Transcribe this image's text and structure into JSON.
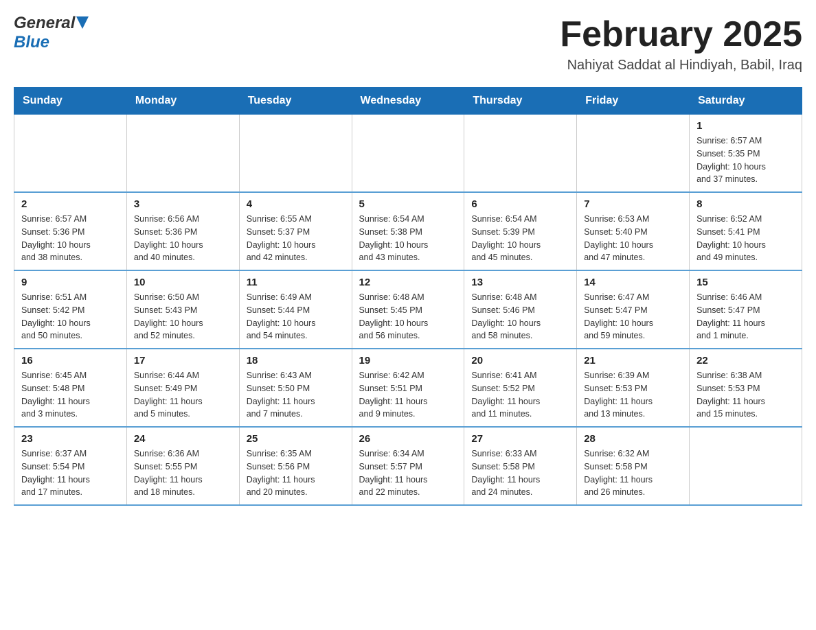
{
  "header": {
    "logo": {
      "general": "General",
      "arrow_color": "#1a6eb5",
      "blue": "Blue"
    },
    "title": "February 2025",
    "location": "Nahiyat Saddat al Hindiyah, Babil, Iraq"
  },
  "calendar": {
    "days_of_week": [
      "Sunday",
      "Monday",
      "Tuesday",
      "Wednesday",
      "Thursday",
      "Friday",
      "Saturday"
    ],
    "weeks": [
      {
        "days": [
          {
            "date": "",
            "info": ""
          },
          {
            "date": "",
            "info": ""
          },
          {
            "date": "",
            "info": ""
          },
          {
            "date": "",
            "info": ""
          },
          {
            "date": "",
            "info": ""
          },
          {
            "date": "",
            "info": ""
          },
          {
            "date": "1",
            "info": "Sunrise: 6:57 AM\nSunset: 5:35 PM\nDaylight: 10 hours\nand 37 minutes."
          }
        ]
      },
      {
        "days": [
          {
            "date": "2",
            "info": "Sunrise: 6:57 AM\nSunset: 5:36 PM\nDaylight: 10 hours\nand 38 minutes."
          },
          {
            "date": "3",
            "info": "Sunrise: 6:56 AM\nSunset: 5:36 PM\nDaylight: 10 hours\nand 40 minutes."
          },
          {
            "date": "4",
            "info": "Sunrise: 6:55 AM\nSunset: 5:37 PM\nDaylight: 10 hours\nand 42 minutes."
          },
          {
            "date": "5",
            "info": "Sunrise: 6:54 AM\nSunset: 5:38 PM\nDaylight: 10 hours\nand 43 minutes."
          },
          {
            "date": "6",
            "info": "Sunrise: 6:54 AM\nSunset: 5:39 PM\nDaylight: 10 hours\nand 45 minutes."
          },
          {
            "date": "7",
            "info": "Sunrise: 6:53 AM\nSunset: 5:40 PM\nDaylight: 10 hours\nand 47 minutes."
          },
          {
            "date": "8",
            "info": "Sunrise: 6:52 AM\nSunset: 5:41 PM\nDaylight: 10 hours\nand 49 minutes."
          }
        ]
      },
      {
        "days": [
          {
            "date": "9",
            "info": "Sunrise: 6:51 AM\nSunset: 5:42 PM\nDaylight: 10 hours\nand 50 minutes."
          },
          {
            "date": "10",
            "info": "Sunrise: 6:50 AM\nSunset: 5:43 PM\nDaylight: 10 hours\nand 52 minutes."
          },
          {
            "date": "11",
            "info": "Sunrise: 6:49 AM\nSunset: 5:44 PM\nDaylight: 10 hours\nand 54 minutes."
          },
          {
            "date": "12",
            "info": "Sunrise: 6:48 AM\nSunset: 5:45 PM\nDaylight: 10 hours\nand 56 minutes."
          },
          {
            "date": "13",
            "info": "Sunrise: 6:48 AM\nSunset: 5:46 PM\nDaylight: 10 hours\nand 58 minutes."
          },
          {
            "date": "14",
            "info": "Sunrise: 6:47 AM\nSunset: 5:47 PM\nDaylight: 10 hours\nand 59 minutes."
          },
          {
            "date": "15",
            "info": "Sunrise: 6:46 AM\nSunset: 5:47 PM\nDaylight: 11 hours\nand 1 minute."
          }
        ]
      },
      {
        "days": [
          {
            "date": "16",
            "info": "Sunrise: 6:45 AM\nSunset: 5:48 PM\nDaylight: 11 hours\nand 3 minutes."
          },
          {
            "date": "17",
            "info": "Sunrise: 6:44 AM\nSunset: 5:49 PM\nDaylight: 11 hours\nand 5 minutes."
          },
          {
            "date": "18",
            "info": "Sunrise: 6:43 AM\nSunset: 5:50 PM\nDaylight: 11 hours\nand 7 minutes."
          },
          {
            "date": "19",
            "info": "Sunrise: 6:42 AM\nSunset: 5:51 PM\nDaylight: 11 hours\nand 9 minutes."
          },
          {
            "date": "20",
            "info": "Sunrise: 6:41 AM\nSunset: 5:52 PM\nDaylight: 11 hours\nand 11 minutes."
          },
          {
            "date": "21",
            "info": "Sunrise: 6:39 AM\nSunset: 5:53 PM\nDaylight: 11 hours\nand 13 minutes."
          },
          {
            "date": "22",
            "info": "Sunrise: 6:38 AM\nSunset: 5:53 PM\nDaylight: 11 hours\nand 15 minutes."
          }
        ]
      },
      {
        "days": [
          {
            "date": "23",
            "info": "Sunrise: 6:37 AM\nSunset: 5:54 PM\nDaylight: 11 hours\nand 17 minutes."
          },
          {
            "date": "24",
            "info": "Sunrise: 6:36 AM\nSunset: 5:55 PM\nDaylight: 11 hours\nand 18 minutes."
          },
          {
            "date": "25",
            "info": "Sunrise: 6:35 AM\nSunset: 5:56 PM\nDaylight: 11 hours\nand 20 minutes."
          },
          {
            "date": "26",
            "info": "Sunrise: 6:34 AM\nSunset: 5:57 PM\nDaylight: 11 hours\nand 22 minutes."
          },
          {
            "date": "27",
            "info": "Sunrise: 6:33 AM\nSunset: 5:58 PM\nDaylight: 11 hours\nand 24 minutes."
          },
          {
            "date": "28",
            "info": "Sunrise: 6:32 AM\nSunset: 5:58 PM\nDaylight: 11 hours\nand 26 minutes."
          },
          {
            "date": "",
            "info": ""
          }
        ]
      }
    ]
  }
}
